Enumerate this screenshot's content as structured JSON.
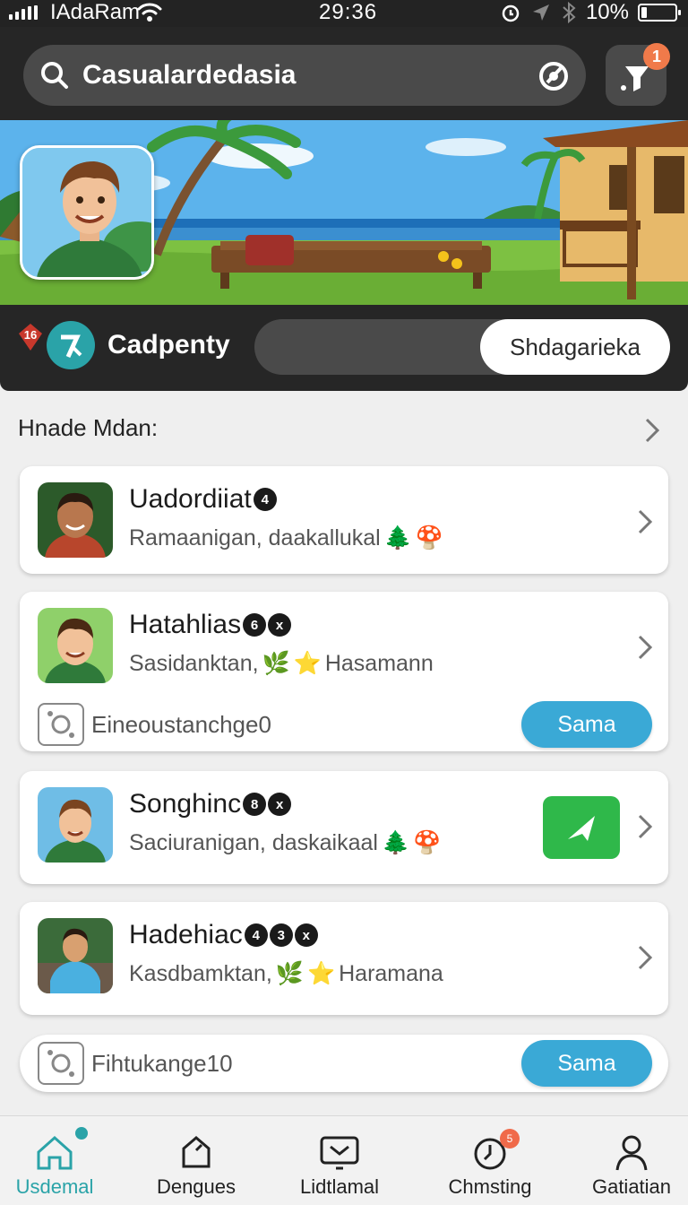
{
  "status_bar": {
    "carrier": "IAdaRam",
    "time": "29:36",
    "battery": "10%"
  },
  "search": {
    "query": "Casualardedasia"
  },
  "filter": {
    "badge": "1"
  },
  "profile": {
    "level_badge": "16",
    "name": "Cadpenty",
    "action": "Shdagarieka"
  },
  "section": {
    "title": "Hnade Mdan:"
  },
  "cards": [
    {
      "title": "Uadordiiat",
      "badges": [
        "4"
      ],
      "subtitle": "Ramaanigan, daakallukal",
      "emojis": [
        "🌲",
        "🍄"
      ]
    },
    {
      "title": "Hatahlias",
      "badges": [
        "6",
        "x"
      ],
      "subtitle": "Sasidanktan,",
      "emojis": [
        "🌿",
        "⭐"
      ],
      "subtitle_tail": "Hasamann",
      "meta": "Eineoustanchge0",
      "button": "Sama"
    },
    {
      "title": "Songhinc",
      "badges": [
        "8",
        "x"
      ],
      "subtitle": "Saciuranigan, daskaikaal",
      "emojis": [
        "🌲",
        "🍄"
      ]
    },
    {
      "title": "Hadehiac",
      "badges": [
        "4",
        "3",
        "x"
      ],
      "subtitle": "Kasdbamktan,",
      "emojis": [
        "🌿",
        "⭐"
      ],
      "subtitle_tail": "Haramana"
    }
  ],
  "extra_card": {
    "meta": "Fihtukange10",
    "button": "Sama"
  },
  "nav": [
    {
      "label": "Usdemal",
      "icon": "home-icon"
    },
    {
      "label": "Dengues",
      "icon": "tag-icon"
    },
    {
      "label": "Lidtlamal",
      "icon": "inbox-icon"
    },
    {
      "label": "Chmsting",
      "icon": "clock-icon",
      "badge": "5"
    },
    {
      "label": "Gatiatian",
      "icon": "profile-icon"
    }
  ],
  "colors": {
    "accent_teal": "#2aa3a8",
    "button_blue": "#3aa9d6",
    "action_green": "#2fb84a",
    "badge_orange": "#f07a4a",
    "header_dark": "#262626"
  }
}
